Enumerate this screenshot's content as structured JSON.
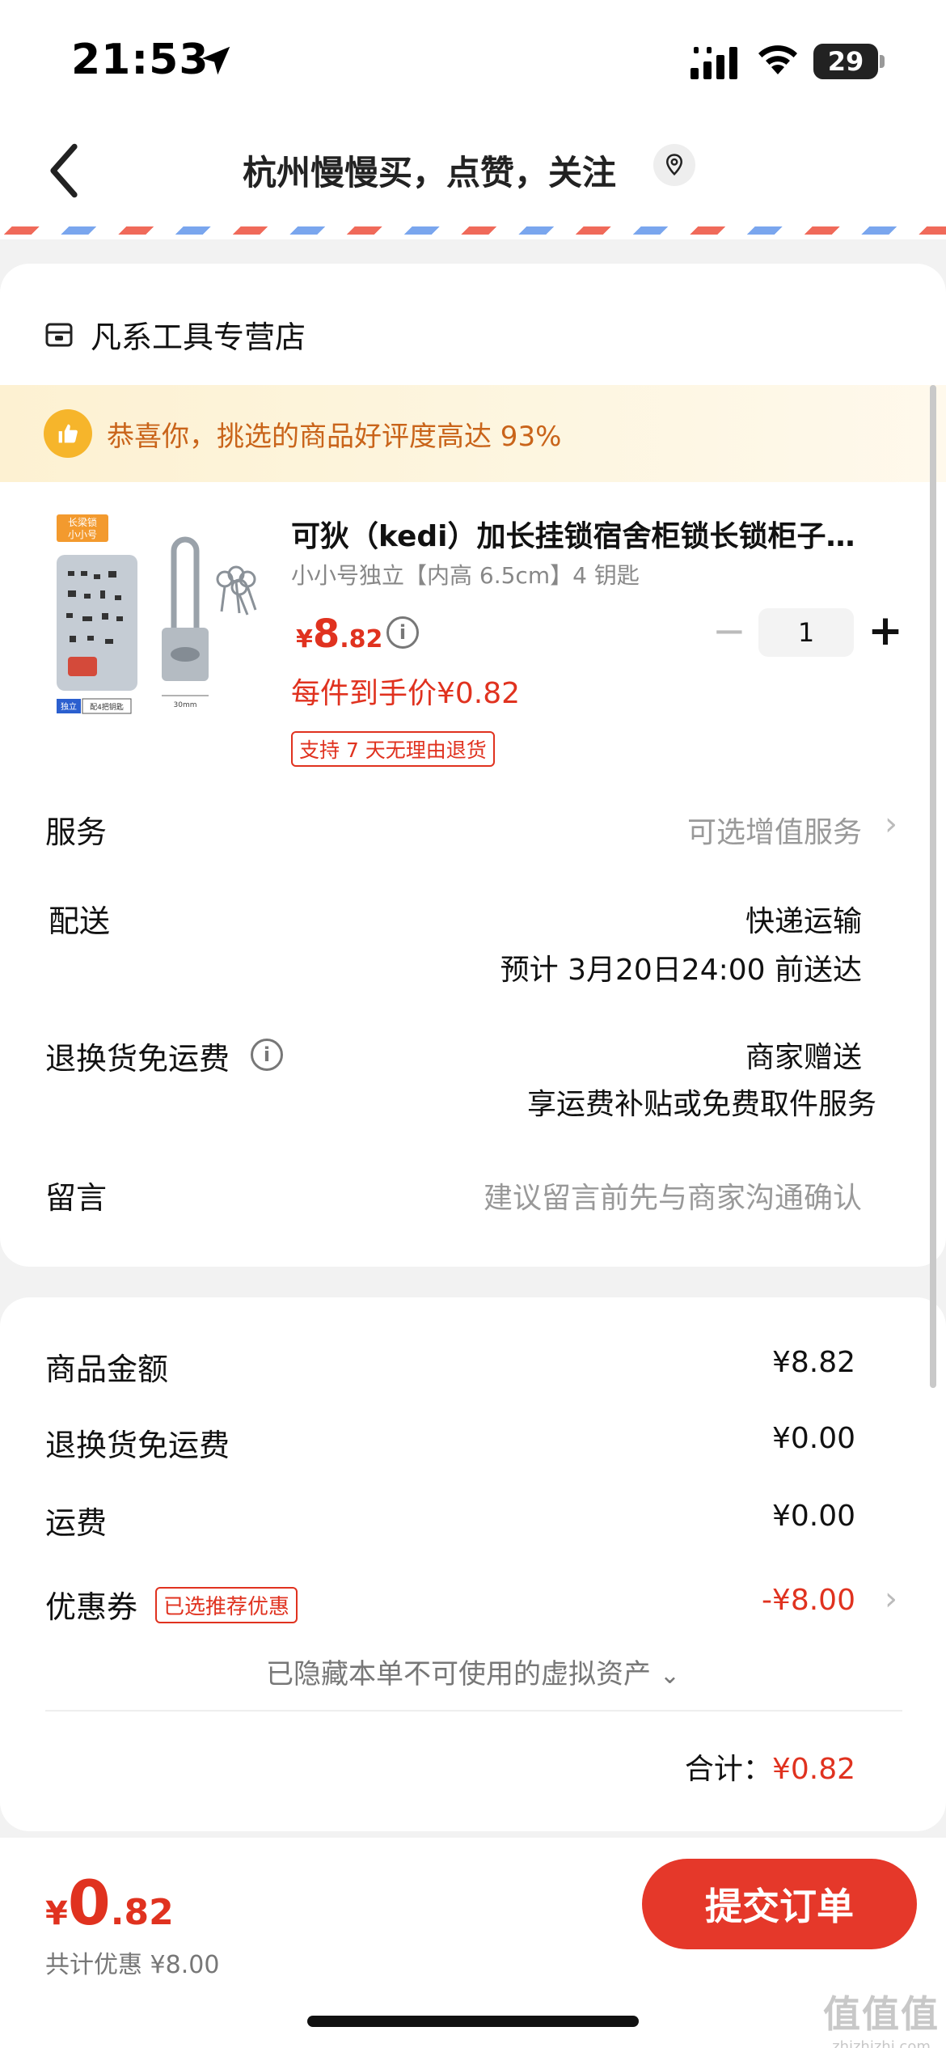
{
  "status_bar": {
    "time": "21:53",
    "battery": "29"
  },
  "nav": {
    "title": "杭州慢慢买，点赞，关注"
  },
  "store": {
    "name": "凡系工具专营店"
  },
  "tip": {
    "text": "恭喜你，挑选的商品好评度高达 93%"
  },
  "product": {
    "image_tag_top": "长梁锁",
    "image_tag_sub": "小小号",
    "image_badge_left": "独立",
    "image_badge_right": "配4把钥匙",
    "image_dim_label": "30mm",
    "title": "可狄（kedi）加长挂锁宿舍柜锁长锁柜子…",
    "sku": "小小号独立【内高 6.5cm】4 钥匙",
    "price_currency": "¥",
    "price_int": "8",
    "price_dec": ".82",
    "unit_price": "每件到手价¥0.82",
    "return_tag": "支持 7 天无理由退货",
    "quantity": "1"
  },
  "rows": {
    "service_label": "服务",
    "service_value": "可选增值服务",
    "delivery_label": "配送",
    "delivery_method": "快递运输",
    "delivery_eta": "预计 3月20日24:00 前送达",
    "return_fee_label": "退换货免运费",
    "return_fee_value1": "商家赠送",
    "return_fee_value2": "享运费补贴或免费取件服务",
    "message_label": "留言",
    "message_placeholder": "建议留言前先与商家沟通确认"
  },
  "summary": {
    "goods_label": "商品金额",
    "goods_value": "¥8.82",
    "return_fee_label": "退换货免运费",
    "return_fee_value": "¥0.00",
    "shipping_label": "运费",
    "shipping_value": "¥0.00",
    "coupon_label": "优惠券",
    "coupon_tag": "已选推荐优惠",
    "coupon_value": "-¥8.00",
    "hidden_assets": "已隐藏本单不可使用的虚拟资产",
    "total_label": "合计：",
    "total_value": "¥0.82"
  },
  "bottom": {
    "currency": "¥",
    "price_int": "0",
    "price_dec": ".82",
    "discount": "共计优惠 ¥8.00",
    "submit": "提交订单"
  },
  "watermark": {
    "line1": "值值值",
    "line2": "zhizhizhi.com"
  },
  "colors": {
    "accent": "#e0321f",
    "submit_bg": "#e5382a",
    "tip_text": "#c9641a"
  }
}
